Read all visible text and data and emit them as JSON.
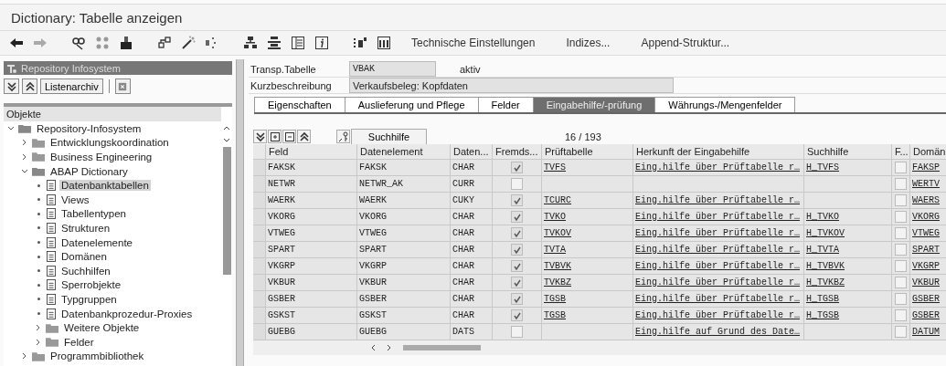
{
  "window": {
    "title": "Dictionary: Tabelle anzeigen"
  },
  "toolbar": {
    "buttons": [
      "Technische Einstellungen",
      "Indizes...",
      "Append-Struktur..."
    ]
  },
  "left_panel": {
    "title": "Repository Infosystem",
    "list_archive_button": "Listenarchiv",
    "objects_header": "Objekte",
    "tree": [
      {
        "label": "Repository-Infosystem",
        "kind": "folder",
        "expanded": true,
        "selected": false,
        "children": [
          {
            "label": "Entwicklungskoordination",
            "kind": "folder",
            "expanded": false,
            "selected": false
          },
          {
            "label": "Business Engineering",
            "kind": "folder",
            "expanded": false,
            "selected": false
          },
          {
            "label": "ABAP Dictionary",
            "kind": "folder",
            "expanded": true,
            "selected": false,
            "children": [
              {
                "label": "Datenbanktabellen",
                "kind": "doc",
                "selected": true
              },
              {
                "label": "Views",
                "kind": "doc",
                "selected": false
              },
              {
                "label": "Tabellentypen",
                "kind": "doc",
                "selected": false
              },
              {
                "label": "Strukturen",
                "kind": "doc",
                "selected": false
              },
              {
                "label": "Datenelemente",
                "kind": "doc",
                "selected": false
              },
              {
                "label": "Domänen",
                "kind": "doc",
                "selected": false
              },
              {
                "label": "Suchhilfen",
                "kind": "doc",
                "selected": false
              },
              {
                "label": "Sperrobjekte",
                "kind": "doc",
                "selected": false
              },
              {
                "label": "Typgruppen",
                "kind": "doc",
                "selected": false
              },
              {
                "label": "Datenbankprozedur-Proxies",
                "kind": "doc",
                "selected": false
              },
              {
                "label": "Weitere Objekte",
                "kind": "folder",
                "expanded": false,
                "selected": false
              },
              {
                "label": "Felder",
                "kind": "folder",
                "expanded": false,
                "selected": false
              }
            ]
          },
          {
            "label": "Programmbibliothek",
            "kind": "folder",
            "expanded": false,
            "selected": false
          }
        ]
      }
    ]
  },
  "header": {
    "table_label": "Transp.Tabelle",
    "table_value": "VBAK",
    "status": "aktiv",
    "description_label": "Kurzbeschreibung",
    "description_value": "Verkaufsbeleg: Kopfdaten"
  },
  "tabs": [
    {
      "label": "Eigenschaften",
      "selected": false
    },
    {
      "label": "Auslieferung und Pflege",
      "selected": false
    },
    {
      "label": "Felder",
      "selected": false
    },
    {
      "label": "Eingabehilfe/-prüfung",
      "selected": true
    },
    {
      "label": "Währungs-/Mengenfelder",
      "selected": false
    }
  ],
  "table_toolbar": {
    "search_help_button": "Suchhilfe",
    "position": "16 / 193"
  },
  "table": {
    "columns": [
      "Feld",
      "Datenelement",
      "Daten...",
      "Fremds...",
      "Prüftabelle",
      "Herkunft der Eingabehilfe",
      "Suchhilfe",
      "F...",
      "Domän"
    ],
    "rows": [
      {
        "feld": "FAKSK",
        "datenelement": "FAKSK",
        "datentyp": "CHAR",
        "fremdschluessel": true,
        "prueftabelle": "TVFS",
        "herkunft": "Eing.hilfe über Prüftabelle r…",
        "suchhilfe": "H_TVFS",
        "column_8": false,
        "domaene": "FAKSP"
      },
      {
        "feld": "NETWR",
        "datenelement": "NETWR_AK",
        "datentyp": "CURR",
        "fremdschluessel": false,
        "column_8": false,
        "domaene": "WERTV"
      },
      {
        "feld": "WAERK",
        "datenelement": "WAERK",
        "datentyp": "CUKY",
        "fremdschluessel": true,
        "prueftabelle": "TCURC",
        "herkunft": "Eing.hilfe über Prüftabelle r…",
        "column_8": false,
        "domaene": "WAERS"
      },
      {
        "feld": "VKORG",
        "datenelement": "VKORG",
        "datentyp": "CHAR",
        "fremdschluessel": true,
        "prueftabelle": "TVKO",
        "herkunft": "Eing.hilfe über Prüftabelle r…",
        "suchhilfe": "H_TVKO",
        "column_8": false,
        "domaene": "VKORG"
      },
      {
        "feld": "VTWEG",
        "datenelement": "VTWEG",
        "datentyp": "CHAR",
        "fremdschluessel": true,
        "prueftabelle": "TVKOV",
        "herkunft": "Eing.hilfe über Prüftabelle r…",
        "suchhilfe": "H_TVKOV",
        "column_8": false,
        "domaene": "VTWEG"
      },
      {
        "feld": "SPART",
        "datenelement": "SPART",
        "datentyp": "CHAR",
        "fremdschluessel": true,
        "prueftabelle": "TVTA",
        "herkunft": "Eing.hilfe über Prüftabelle r…",
        "suchhilfe": "H_TVTA",
        "column_8": false,
        "domaene": "SPART"
      },
      {
        "feld": "VKGRP",
        "datenelement": "VKGRP",
        "datentyp": "CHAR",
        "fremdschluessel": true,
        "prueftabelle": "TVBVK",
        "herkunft": "Eing.hilfe über Prüftabelle r…",
        "suchhilfe": "H_TVBVK",
        "column_8": false,
        "domaene": "VKGRP"
      },
      {
        "feld": "VKBUR",
        "datenelement": "VKBUR",
        "datentyp": "CHAR",
        "fremdschluessel": true,
        "prueftabelle": "TVKBZ",
        "herkunft": "Eing.hilfe über Prüftabelle r…",
        "suchhilfe": "H_TVKBZ",
        "column_8": false,
        "domaene": "VKBUR"
      },
      {
        "feld": "GSBER",
        "datenelement": "GSBER",
        "datentyp": "CHAR",
        "fremdschluessel": true,
        "prueftabelle": "TGSB",
        "herkunft": "Eing.hilfe über Prüftabelle r…",
        "suchhilfe": "H_TGSB",
        "column_8": false,
        "domaene": "GSBER"
      },
      {
        "feld": "GSKST",
        "datenelement": "GSKST",
        "datentyp": "CHAR",
        "fremdschluessel": true,
        "prueftabelle": "TGSB",
        "herkunft": "Eing.hilfe über Prüftabelle r…",
        "suchhilfe": "H_TGSB",
        "column_8": false,
        "domaene": "GSBER"
      },
      {
        "feld": "GUEBG",
        "datenelement": "GUEBG",
        "datentyp": "DATS",
        "fremdschluessel": false,
        "herkunft": "Eing.hilfe auf Grund des Date…",
        "column_8": false,
        "domaene": "DATUM"
      }
    ]
  }
}
